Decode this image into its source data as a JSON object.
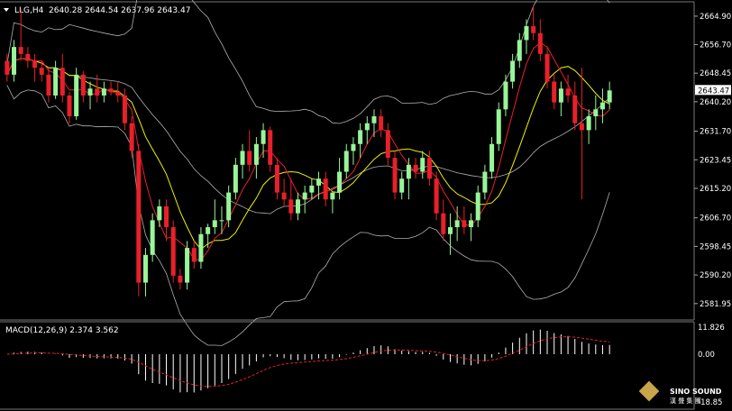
{
  "header": {
    "symbol": "LLG,H4",
    "ohlc": "2640.28 2644.54 2637.96 2643.47"
  },
  "macd": {
    "label": "MACD(12,26,9) 2.374 3.562",
    "axis": [
      "11.826",
      "0.00",
      "-18.85"
    ]
  },
  "watermark": {
    "line1": "SINO SOUND",
    "line2": "漢 聲 集 團"
  },
  "colors": {
    "background": "#000000",
    "bull": "#98f598",
    "bear": "#e8202a",
    "ma_fast": "#e8202a",
    "ma_slow": "#f0f000",
    "bands": "#b0b0b0",
    "macd_hist": "#ffffff",
    "macd_signal": "#e8202a",
    "current_price_bg": "#ffffff"
  },
  "chart_data": {
    "type": "candlestick",
    "price_axis": {
      "range": [
        2578.0,
        2668.0
      ],
      "ticks": [
        "2664.90",
        "2656.70",
        "2648.45",
        "2640.20",
        "2631.70",
        "2623.45",
        "2615.20",
        "2606.70",
        "2598.45",
        "2590.20",
        "2581.95"
      ],
      "current_price": "2643.47"
    },
    "candles": [
      [
        2652,
        2654,
        2646,
        2648
      ],
      [
        2648,
        2658,
        2646,
        2656
      ],
      [
        2656,
        2667,
        2652,
        2654
      ],
      [
        2654,
        2656,
        2650,
        2652
      ],
      [
        2652,
        2654,
        2646,
        2650
      ],
      [
        2650,
        2652,
        2646,
        2648
      ],
      [
        2648,
        2650,
        2640,
        2642
      ],
      [
        2642,
        2652,
        2641,
        2650
      ],
      [
        2650,
        2654,
        2640,
        2642
      ],
      [
        2642,
        2643,
        2634,
        2636
      ],
      [
        2636,
        2650,
        2635,
        2648
      ],
      [
        2648,
        2649,
        2640,
        2642
      ],
      [
        2642,
        2646,
        2638,
        2644
      ],
      [
        2644,
        2648,
        2640,
        2642
      ],
      [
        2642,
        2646,
        2640,
        2644
      ],
      [
        2644,
        2646,
        2642,
        2643
      ],
      [
        2643,
        2646,
        2640,
        2642
      ],
      [
        2642,
        2644,
        2632,
        2634
      ],
      [
        2634,
        2636,
        2624,
        2626
      ],
      [
        2626,
        2628,
        2584,
        2588
      ],
      [
        2588,
        2598,
        2584,
        2596
      ],
      [
        2596,
        2608,
        2594,
        2606
      ],
      [
        2606,
        2612,
        2604,
        2610
      ],
      [
        2610,
        2612,
        2600,
        2604
      ],
      [
        2604,
        2606,
        2588,
        2590
      ],
      [
        2590,
        2592,
        2586,
        2588
      ],
      [
        2588,
        2600,
        2586,
        2598
      ],
      [
        2598,
        2600,
        2592,
        2594
      ],
      [
        2594,
        2604,
        2592,
        2602
      ],
      [
        2602,
        2605,
        2598,
        2604
      ],
      [
        2604,
        2612,
        2602,
        2606
      ],
      [
        2606,
        2610,
        2602,
        2606
      ],
      [
        2606,
        2616,
        2604,
        2614
      ],
      [
        2614,
        2624,
        2612,
        2622
      ],
      [
        2622,
        2628,
        2618,
        2626
      ],
      [
        2626,
        2632,
        2620,
        2622
      ],
      [
        2622,
        2630,
        2618,
        2628
      ],
      [
        2628,
        2634,
        2624,
        2632
      ],
      [
        2632,
        2633,
        2620,
        2622
      ],
      [
        2622,
        2624,
        2612,
        2614
      ],
      [
        2614,
        2618,
        2610,
        2612
      ],
      [
        2612,
        2618,
        2606,
        2608
      ],
      [
        2608,
        2614,
        2606,
        2612
      ],
      [
        2612,
        2616,
        2608,
        2614
      ],
      [
        2614,
        2618,
        2612,
        2616
      ],
      [
        2616,
        2620,
        2612,
        2618
      ],
      [
        2618,
        2620,
        2610,
        2612
      ],
      [
        2612,
        2614,
        2608,
        2614
      ],
      [
        2614,
        2624,
        2612,
        2620
      ],
      [
        2620,
        2628,
        2618,
        2626
      ],
      [
        2626,
        2630,
        2622,
        2628
      ],
      [
        2628,
        2634,
        2624,
        2632
      ],
      [
        2632,
        2636,
        2628,
        2634
      ],
      [
        2634,
        2638,
        2630,
        2636
      ],
      [
        2636,
        2638,
        2630,
        2632
      ],
      [
        2632,
        2634,
        2622,
        2624
      ],
      [
        2624,
        2626,
        2612,
        2614
      ],
      [
        2614,
        2620,
        2612,
        2618
      ],
      [
        2618,
        2624,
        2612,
        2622
      ],
      [
        2622,
        2624,
        2618,
        2620
      ],
      [
        2620,
        2626,
        2618,
        2624
      ],
      [
        2624,
        2626,
        2616,
        2618
      ],
      [
        2618,
        2620,
        2606,
        2608
      ],
      [
        2608,
        2612,
        2600,
        2602
      ],
      [
        2602,
        2608,
        2596,
        2604
      ],
      [
        2604,
        2610,
        2600,
        2606
      ],
      [
        2606,
        2610,
        2602,
        2604
      ],
      [
        2604,
        2608,
        2600,
        2606
      ],
      [
        2606,
        2616,
        2604,
        2614
      ],
      [
        2614,
        2622,
        2612,
        2620
      ],
      [
        2620,
        2630,
        2618,
        2628
      ],
      [
        2628,
        2640,
        2626,
        2638
      ],
      [
        2638,
        2648,
        2636,
        2646
      ],
      [
        2646,
        2654,
        2644,
        2652
      ],
      [
        2652,
        2660,
        2650,
        2658
      ],
      [
        2658,
        2664,
        2654,
        2662
      ],
      [
        2662,
        2668,
        2658,
        2660
      ],
      [
        2660,
        2664,
        2652,
        2654
      ],
      [
        2654,
        2656,
        2644,
        2646
      ],
      [
        2646,
        2648,
        2638,
        2640
      ],
      [
        2640,
        2646,
        2636,
        2644
      ],
      [
        2644,
        2648,
        2640,
        2642
      ],
      [
        2642,
        2646,
        2632,
        2634
      ],
      [
        2634,
        2650,
        2612,
        2632
      ],
      [
        2632,
        2638,
        2628,
        2636
      ],
      [
        2636,
        2642,
        2632,
        2638
      ],
      [
        2638,
        2644,
        2634,
        2640
      ],
      [
        2640,
        2646,
        2638,
        2643.47
      ]
    ]
  }
}
